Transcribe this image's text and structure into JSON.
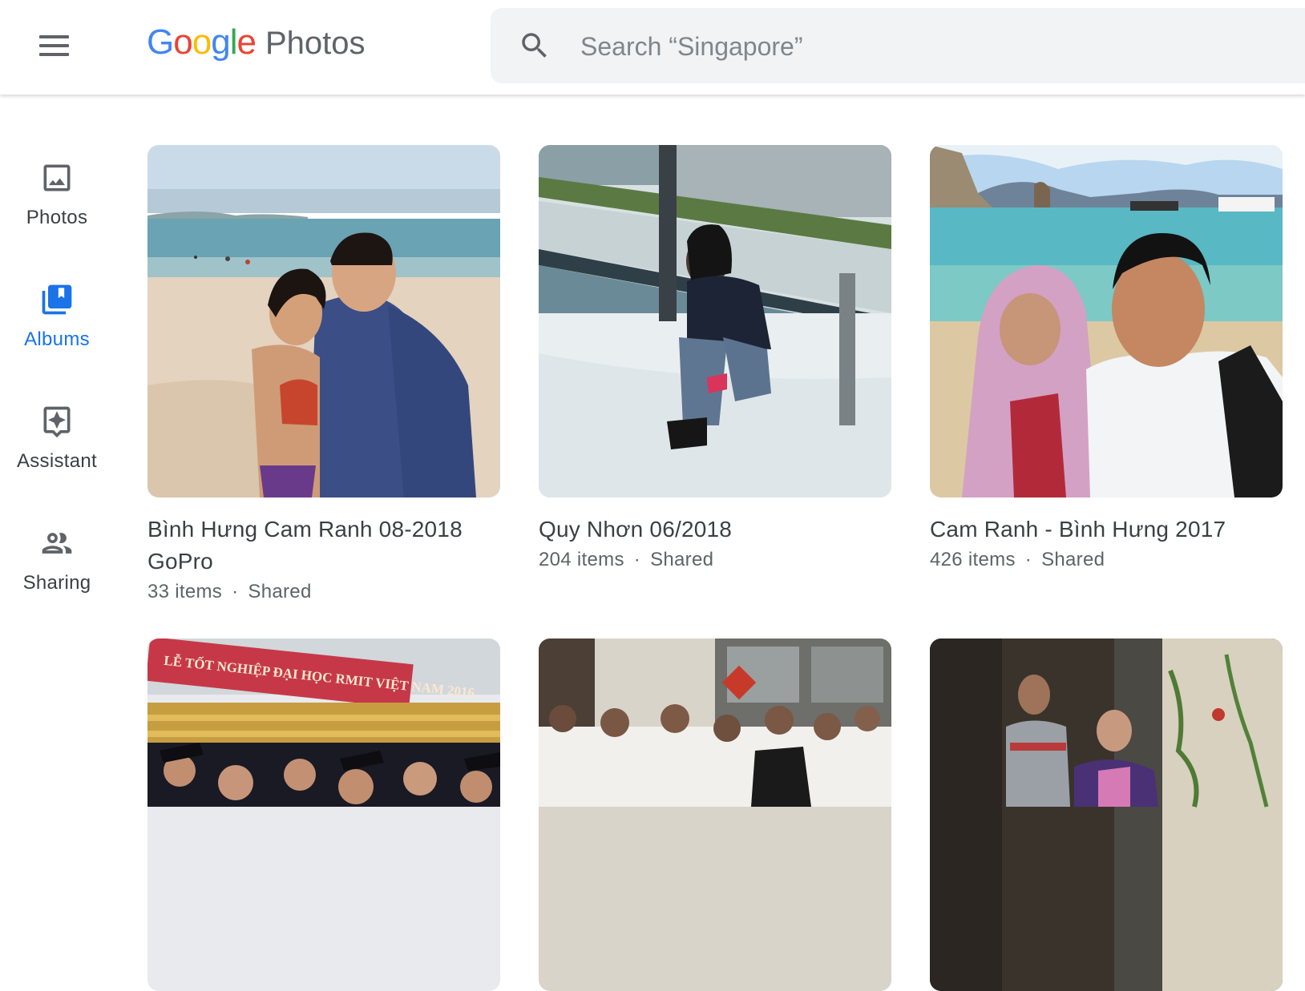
{
  "header": {
    "logo_google": [
      "G",
      "o",
      "o",
      "g",
      "l",
      "e"
    ],
    "logo_colors": [
      "#4285F4",
      "#EA4335",
      "#FBBC05",
      "#4285F4",
      "#34A853",
      "#EA4335"
    ],
    "product_name": "Photos",
    "search_placeholder": "Search “Singapore”"
  },
  "sidebar": {
    "items": [
      {
        "label": "Photos",
        "icon": "photo-icon",
        "active": false
      },
      {
        "label": "Albums",
        "icon": "album-icon",
        "active": true
      },
      {
        "label": "Assistant",
        "icon": "assistant-icon",
        "active": false
      },
      {
        "label": "Sharing",
        "icon": "people-icon",
        "active": false
      }
    ],
    "active_color": "#1a73e8"
  },
  "albums": [
    {
      "title": "Bình Hưng Cam Ranh 08-2018 GoPro",
      "count": "33 items",
      "separator": "·",
      "status": "Shared"
    },
    {
      "title": "Quy Nhơn 06/2018",
      "count": "204 items",
      "separator": "·",
      "status": "Shared"
    },
    {
      "title": "Cam Ranh - Bình Hưng 2017",
      "count": "426 items",
      "separator": "·",
      "status": "Shared"
    },
    {
      "banner_text": "LỄ TỐT NGHIỆP ĐẠI HỌC RMIT VIỆT NAM 2016"
    },
    {},
    {}
  ]
}
